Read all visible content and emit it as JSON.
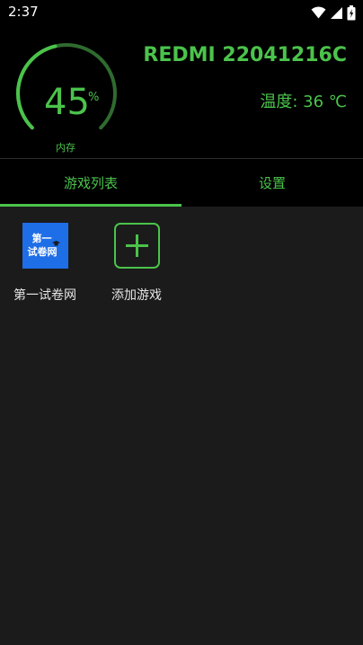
{
  "status_bar": {
    "time": "2:37",
    "icons": [
      "wifi-icon",
      "cellular-signal-icon",
      "battery-icon"
    ]
  },
  "header": {
    "memory_gauge": {
      "value": "45",
      "unit": "%",
      "label": "内存",
      "fraction": 0.45,
      "color": "#4bc34b"
    },
    "device_name": "REDMI 22041216C",
    "temperature": "温度: 36 ℃"
  },
  "tabs": [
    {
      "label": "游戏列表",
      "active": true
    },
    {
      "label": "设置",
      "active": false
    }
  ],
  "games": [
    {
      "name": "第一试卷网",
      "logo_lines": [
        "第一",
        "试卷网"
      ],
      "logo_color": "#1e6ee8"
    },
    {
      "name": "添加游戏",
      "icon": "plus-icon"
    }
  ],
  "colors": {
    "accent": "#4bc34b",
    "background": "#1b1b1b",
    "header_background": "#000000"
  }
}
